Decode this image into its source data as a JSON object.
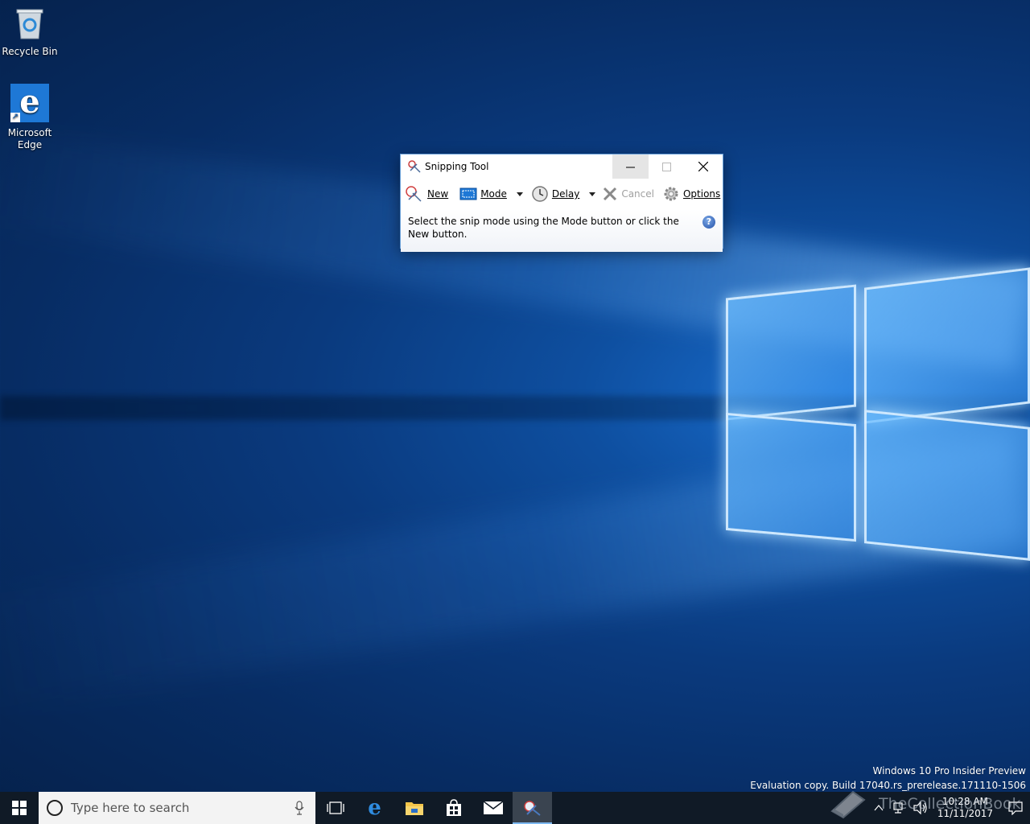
{
  "desktop": {
    "icons": [
      {
        "label": "Recycle Bin"
      },
      {
        "label": "Microsoft Edge"
      }
    ]
  },
  "snipping_tool": {
    "title": "Snipping Tool",
    "toolbar": {
      "new_label": "New",
      "mode_label": "Mode",
      "delay_label": "Delay",
      "cancel_label": "Cancel",
      "options_label": "Options"
    },
    "message": "Select the snip mode using the Mode button or click the New button.",
    "help_glyph": "?"
  },
  "watermark": {
    "line1": "Windows 10 Pro Insider Preview",
    "line2": "Evaluation copy. Build 17040.rs_prerelease.171110-1506"
  },
  "taskbar": {
    "search_placeholder": "Type here to search",
    "clock_time": "10:28 AM",
    "clock_date": "11/11/2017",
    "apps": [
      "task-view",
      "edge",
      "file-explorer",
      "store",
      "mail",
      "snipping-tool"
    ]
  },
  "overlay_watermark": "TheCollectionBook",
  "colors": {
    "taskbar": "#101a26",
    "accent": "#1e78d6",
    "window_border": "#6aa0d8"
  }
}
